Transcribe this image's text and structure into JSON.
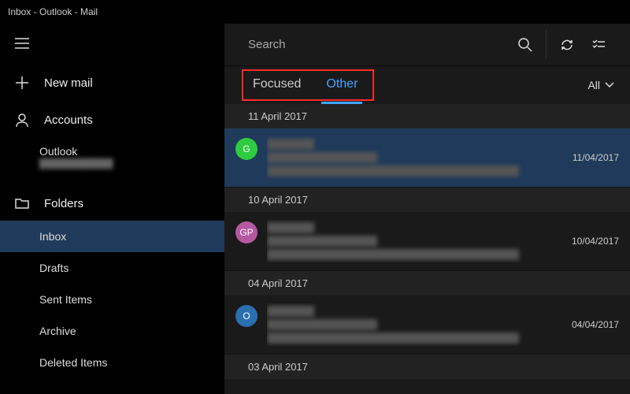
{
  "window_title": "Inbox - Outlook - Mail",
  "sidebar": {
    "new_mail": "New mail",
    "accounts_label": "Accounts",
    "accounts": [
      {
        "name": "Outlook"
      }
    ],
    "folders_label": "Folders",
    "folders": [
      {
        "label": "Inbox",
        "selected": true
      },
      {
        "label": "Drafts",
        "selected": false
      },
      {
        "label": "Sent Items",
        "selected": false
      },
      {
        "label": "Archive",
        "selected": false
      },
      {
        "label": "Deleted Items",
        "selected": false
      }
    ]
  },
  "search": {
    "placeholder": "Search"
  },
  "tabs": {
    "focused": "Focused",
    "other": "Other",
    "filter_label": "All"
  },
  "groups": [
    {
      "date_label": "11 April 2017",
      "messages": [
        {
          "avatar": "G",
          "avatar_color": "#2ecc40",
          "date": "11/04/2017",
          "selected": true
        }
      ]
    },
    {
      "date_label": "10 April 2017",
      "messages": [
        {
          "avatar": "GP",
          "avatar_color": "#b558a0",
          "date": "10/04/2017",
          "selected": false
        }
      ]
    },
    {
      "date_label": "04 April 2017",
      "messages": [
        {
          "avatar": "O",
          "avatar_color": "#2a6fb0",
          "date": "04/04/2017",
          "selected": false
        }
      ]
    },
    {
      "date_label": "03 April 2017",
      "messages": []
    }
  ]
}
